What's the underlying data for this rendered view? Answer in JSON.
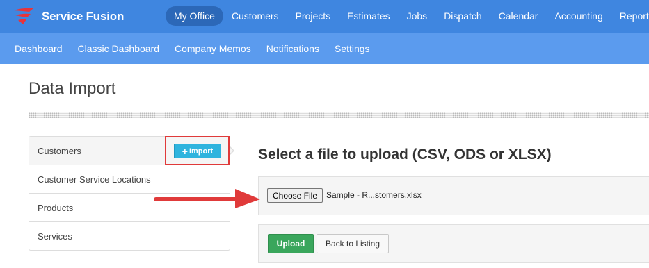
{
  "app": {
    "brand": "Service Fusion",
    "brand_color": "#3f86e0"
  },
  "main_nav": [
    {
      "label": "My Office",
      "active": true
    },
    {
      "label": "Customers"
    },
    {
      "label": "Projects"
    },
    {
      "label": "Estimates"
    },
    {
      "label": "Jobs"
    },
    {
      "label": "Dispatch"
    },
    {
      "label": "Calendar"
    },
    {
      "label": "Accounting"
    },
    {
      "label": "Reports"
    }
  ],
  "sub_nav": [
    {
      "label": "Dashboard"
    },
    {
      "label": "Classic Dashboard"
    },
    {
      "label": "Company Memos"
    },
    {
      "label": "Notifications"
    },
    {
      "label": "Settings"
    }
  ],
  "page": {
    "title": "Data Import"
  },
  "sidebar": {
    "items": [
      {
        "label": "Customers",
        "active": true
      },
      {
        "label": "Customer Service Locations"
      },
      {
        "label": "Products"
      },
      {
        "label": "Services"
      }
    ],
    "import_button": {
      "icon": "plus-icon",
      "label": "Import",
      "color": "#2fb4de"
    }
  },
  "upload": {
    "heading": "Select a file to upload (CSV, ODS or XLSX)",
    "choose_file_label": "Choose File",
    "file_name": "Sample - R...stomers.xlsx",
    "upload_label": "Upload",
    "back_label": "Back to Listing",
    "upload_color": "#3aa65c"
  },
  "annotations": {
    "highlight_color": "#e03a3a",
    "arrow_icon": "arrow-right-icon"
  }
}
